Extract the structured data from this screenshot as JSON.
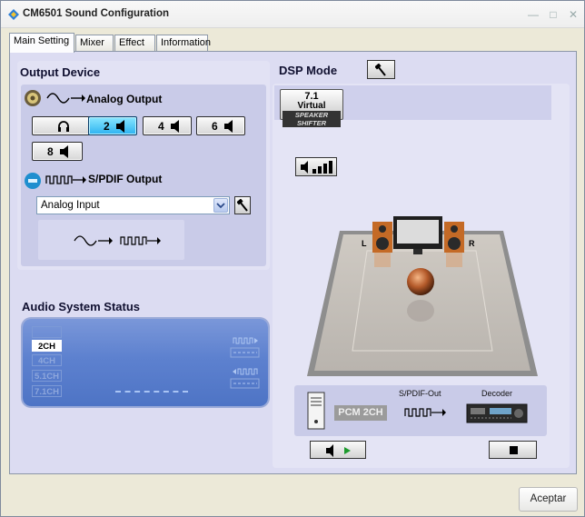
{
  "window": {
    "title": "CM6501 Sound Configuration"
  },
  "tabs": [
    {
      "label": "Main Setting",
      "active": true
    },
    {
      "label": "Mixer"
    },
    {
      "label": "Effect"
    },
    {
      "label": "Information"
    }
  ],
  "output_device": {
    "heading": "Output Device",
    "analog_label": "Analog Output",
    "speaker_buttons": [
      {
        "id": "headphone",
        "label": ""
      },
      {
        "id": "2ch",
        "label": "2",
        "selected": true
      },
      {
        "id": "4ch",
        "label": "4"
      },
      {
        "id": "6ch",
        "label": "6"
      },
      {
        "id": "8ch",
        "label": "8"
      }
    ],
    "spdif_label": "S/PDIF Output",
    "spdif_source": {
      "value": "Analog Input"
    }
  },
  "audio_status": {
    "heading": "Audio System Status",
    "channels": [
      {
        "label": "",
        "active": false
      },
      {
        "label": "2CH",
        "active": true
      },
      {
        "label": "4CH",
        "active": false
      },
      {
        "label": "5.1CH",
        "active": false
      },
      {
        "label": "7.1CH",
        "active": false
      }
    ]
  },
  "dsp": {
    "heading": "DSP Mode",
    "virtual_button": {
      "line1": "7.1",
      "line2": "Virtual",
      "line3": "SPEAKER SHIFTER"
    },
    "room": {
      "left_label": "L",
      "right_label": "R"
    },
    "flow": {
      "pcm_label": "PCM 2CH",
      "spdif_out_label": "S/PDIF-Out",
      "decoder_label": "Decoder"
    }
  },
  "footer": {
    "accept_label": "Aceptar"
  },
  "colors": {
    "selected_button": "#2cb2f0",
    "status_screen": "#5d81cf",
    "panel": "#dcdcf2"
  }
}
